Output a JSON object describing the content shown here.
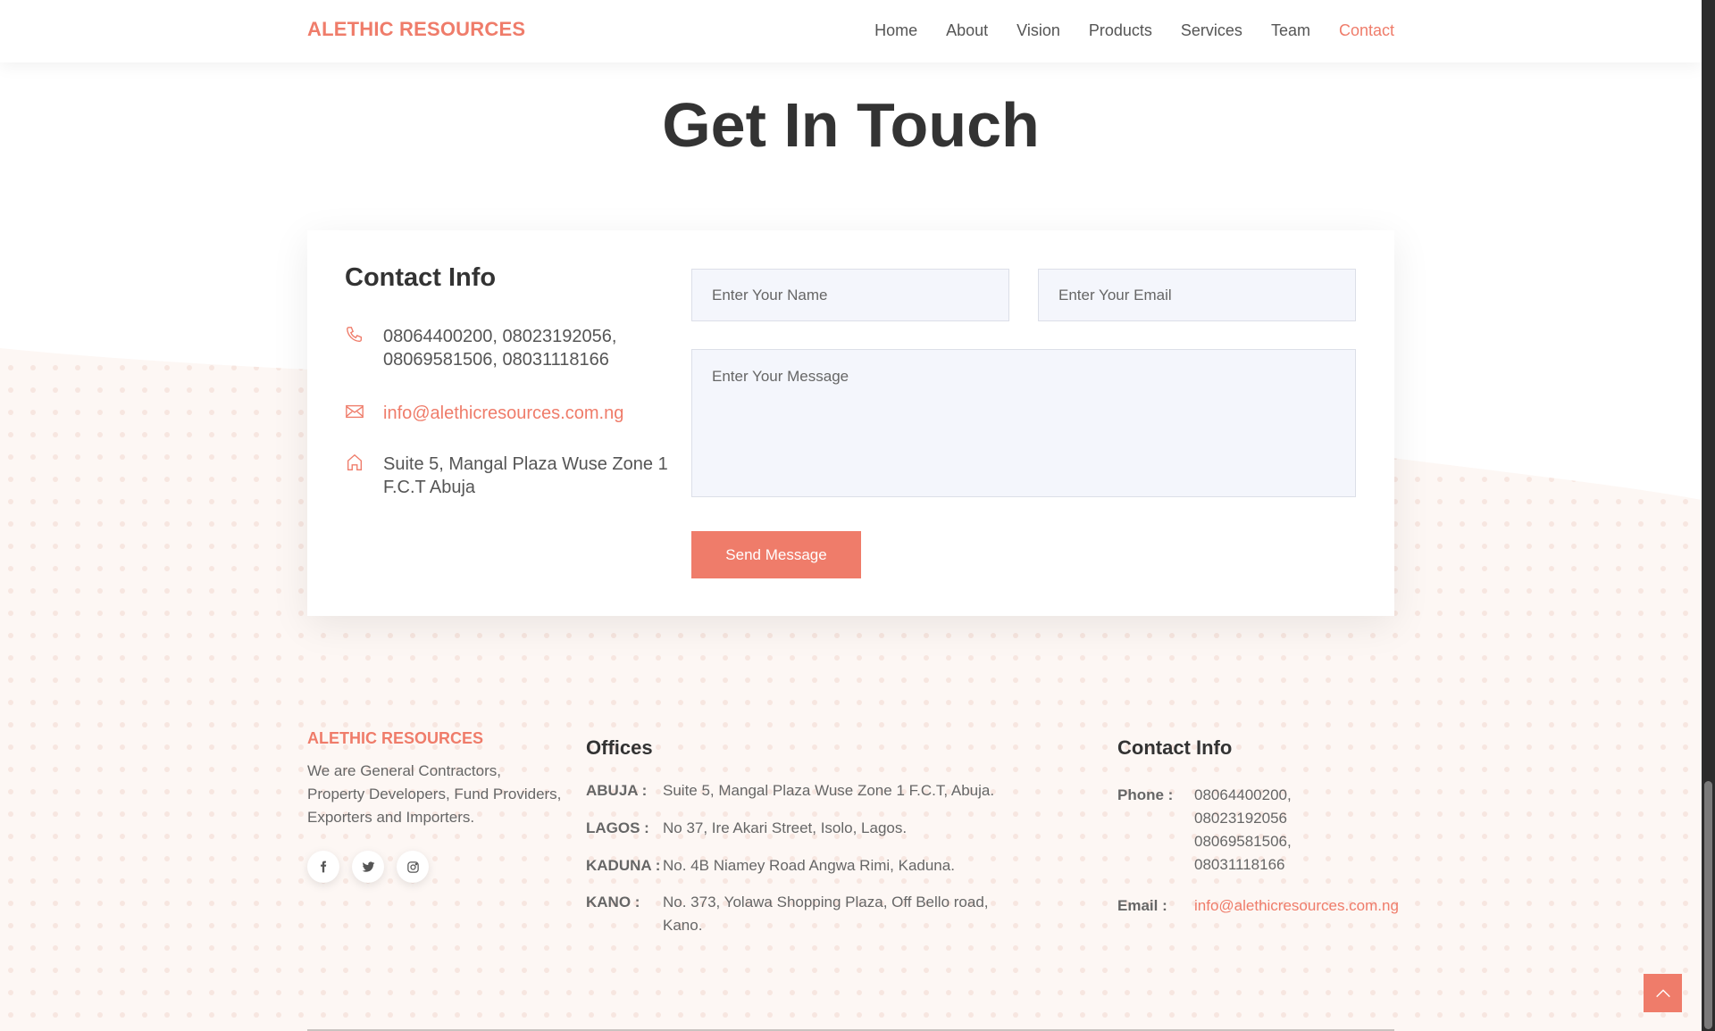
{
  "header": {
    "brand": "ALETHIC RESOURCES",
    "nav": [
      {
        "label": "Home",
        "active": false
      },
      {
        "label": "About",
        "active": false
      },
      {
        "label": "Vision",
        "active": false
      },
      {
        "label": "Products",
        "active": false
      },
      {
        "label": "Services",
        "active": false
      },
      {
        "label": "Team",
        "active": false
      },
      {
        "label": "Contact",
        "active": true
      }
    ]
  },
  "page_title": "Get In Touch",
  "contact_card": {
    "heading": "Contact Info",
    "phone": "08064400200, 08023192056, 08069581506, 08031118166",
    "email": "info@alethicresources.com.ng",
    "address": "Suite 5, Mangal Plaza Wuse Zone 1 F.C.T Abuja",
    "form": {
      "name_placeholder": "Enter Your Name",
      "email_placeholder": "Enter Your Email",
      "message_placeholder": "Enter Your Message",
      "submit_label": "Send Message"
    }
  },
  "footer": {
    "brand": "ALETHIC RESOURCES",
    "description": "We are General Contractors, Property Developers, Fund Providers, Exporters and Importers.",
    "socials": [
      "facebook-icon",
      "twitter-icon",
      "instagram-icon"
    ],
    "offices_heading": "Offices",
    "offices": [
      {
        "label": "ABUJA :",
        "address": "Suite 5, Mangal Plaza Wuse Zone 1 F.C.T, Abuja."
      },
      {
        "label": "LAGOS :",
        "address": "No 37, Ire Akari Street, Isolo, Lagos."
      },
      {
        "label": "KADUNA :",
        "address": "No. 4B Niamey Road Angwa Rimi, Kaduna."
      },
      {
        "label": "KANO :",
        "address": "No. 373, Yolawa Shopping Plaza, Off Bello road, Kano."
      }
    ],
    "contact_heading": "Contact Info",
    "phone_label": "Phone :",
    "phone_value": "08064400200, 08023192056 08069581506, 08031118166",
    "email_label": "Email :",
    "email_value": "info@alethicresources.com.ng"
  },
  "colors": {
    "accent": "#ef7c6a",
    "text": "#444444",
    "input_bg": "#f4f6fc"
  }
}
